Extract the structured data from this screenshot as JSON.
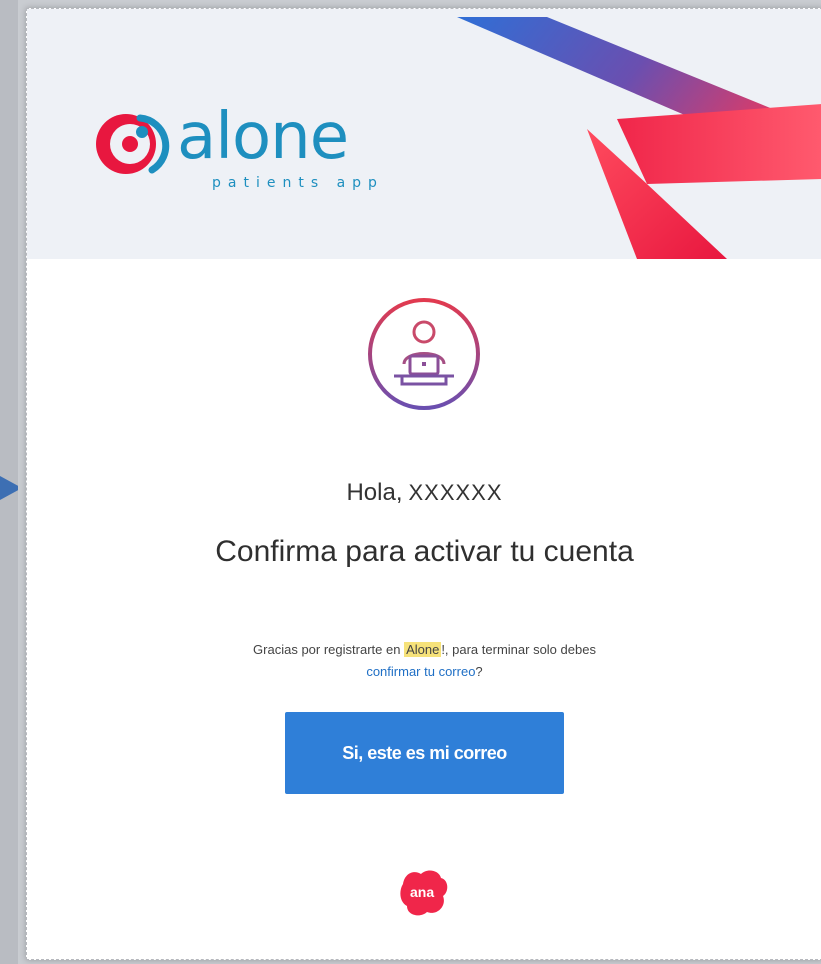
{
  "brand": {
    "name": "alone",
    "tagline": "patients app",
    "colors": {
      "primary": "#1e8fbf",
      "accent_red": "#f0264a",
      "accent_blue": "#2f7fd8",
      "header_bg": "#eef1f6"
    }
  },
  "icons": {
    "logo": "alone-logo-mark",
    "user": "person-at-laptop-icon",
    "footer": "pana-logo"
  },
  "greeting": {
    "prefix": "Hola,",
    "name": "XXXXXX"
  },
  "headline": "Confirma para activar tu cuenta",
  "message": {
    "before": "Gracias por registrarte en ",
    "brand": "Alone",
    "after": "!,  para terminar solo debes",
    "link": "confirmar tu correo",
    "end": "?"
  },
  "cta": {
    "label": "Si, este es mi correo"
  },
  "footer": {
    "logo_text": "ana"
  }
}
